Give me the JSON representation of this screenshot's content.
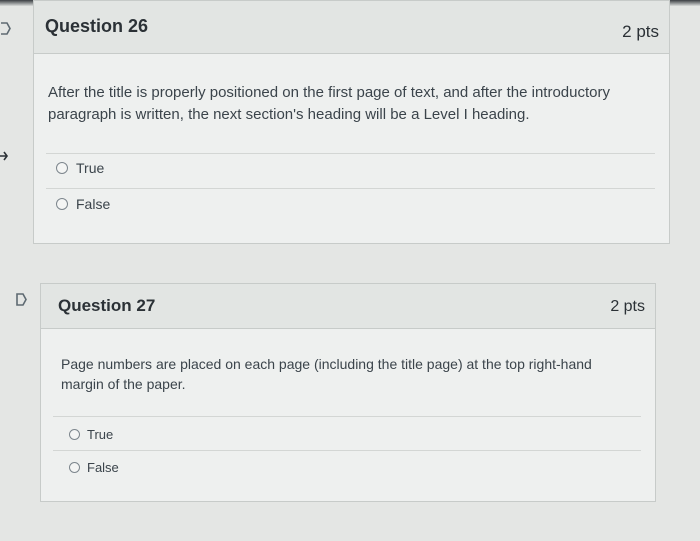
{
  "questions": [
    {
      "title": "Question 26",
      "points": "2 pts",
      "text": "After the title is properly positioned on the first page of text, and after the introductory paragraph is written, the next section's heading will be a Level I heading.",
      "options": [
        "True",
        "False"
      ]
    },
    {
      "title": "Question 27",
      "points": "2 pts",
      "text": "Page numbers are placed on each page (including the title page) at the top right-hand margin of the paper.",
      "options": [
        "True",
        "False"
      ]
    }
  ],
  "icons": {
    "question_flag": "flag-icon",
    "radio": "radio-icon"
  },
  "colors": {
    "card_background": "#eef0ef",
    "header_background": "#e2e5e3",
    "border": "#c7cbc9",
    "text": "#3b444b"
  }
}
